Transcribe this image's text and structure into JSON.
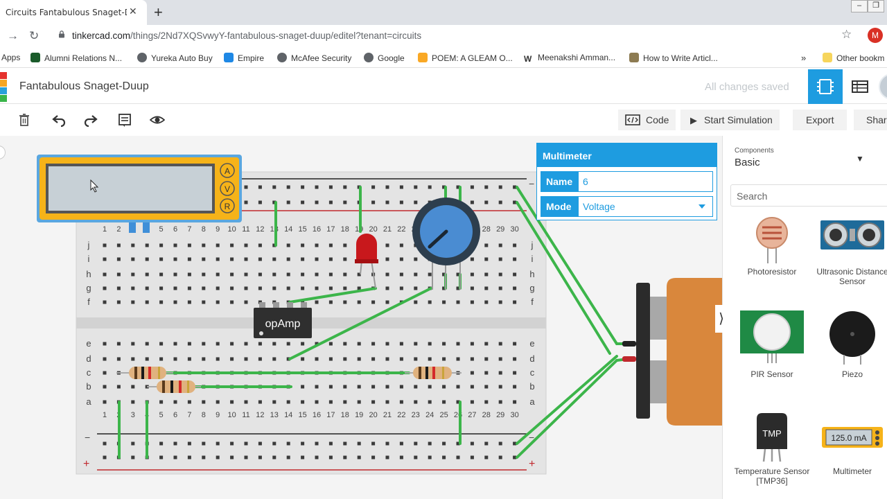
{
  "browser": {
    "tab_title": "Circuits Fantabulous Snaget-Duup",
    "url_host": "tinkercad.com",
    "url_path": "/things/2Nd7XQSvwyY-fantabulous-snaget-duup/editel?tenant=circuits",
    "profile_initial": "M",
    "bookmarks": [
      "Apps",
      "Alumni Relations N...",
      "Yureka Auto Buy",
      "Empire",
      "McAfee Security",
      "Google",
      "POEM: A GLEAM O...",
      "Meenakshi Amman...",
      "How to Write Articl...",
      "Other bookm"
    ]
  },
  "header": {
    "project_title": "Fantabulous Snaget-Duup",
    "save_status": "All changes saved"
  },
  "toolbar": {
    "code_label": "Code",
    "start_sim_label": "Start Simulation",
    "export_label": "Export",
    "share_label": "Shar"
  },
  "inspector": {
    "title": "Multimeter",
    "name_label": "Name",
    "name_value": "6",
    "mode_label": "Mode",
    "mode_value": "Voltage"
  },
  "panel": {
    "components_label": "Components",
    "components_value": "Basic",
    "search_placeholder": "Search",
    "items": [
      {
        "label": "Photoresistor"
      },
      {
        "label": "Ultrasonic Distance Sensor"
      },
      {
        "label": "PIR Sensor"
      },
      {
        "label": "Piezo"
      },
      {
        "label": "Temperature Sensor [TMP36]"
      },
      {
        "label": "Multimeter"
      }
    ],
    "tmp_chip_text": "TMP",
    "multimeter_preview_reading": "125.0 mA"
  },
  "canvas": {
    "multimeter_terminals": [
      "A",
      "V",
      "R"
    ],
    "opamp_label": "opAmp",
    "column_numbers": [
      "1",
      "2",
      "3",
      "4",
      "5",
      "6",
      "7",
      "8",
      "9",
      "10",
      "11",
      "12",
      "13",
      "14",
      "15",
      "16",
      "17",
      "18",
      "19",
      "20",
      "21",
      "22",
      "23",
      "24",
      "25",
      "26",
      "27",
      "28",
      "29",
      "30"
    ],
    "top_rows": [
      "j",
      "i",
      "h",
      "g",
      "f"
    ],
    "bottom_rows": [
      "e",
      "d",
      "c",
      "b",
      "a"
    ],
    "rail_minus": "−",
    "rail_plus": "+"
  },
  "colors": {
    "accent": "#1e9ce0",
    "wire": "#3cb54a",
    "multimeter_body": "#f6b319",
    "battery": "#d9873c"
  }
}
